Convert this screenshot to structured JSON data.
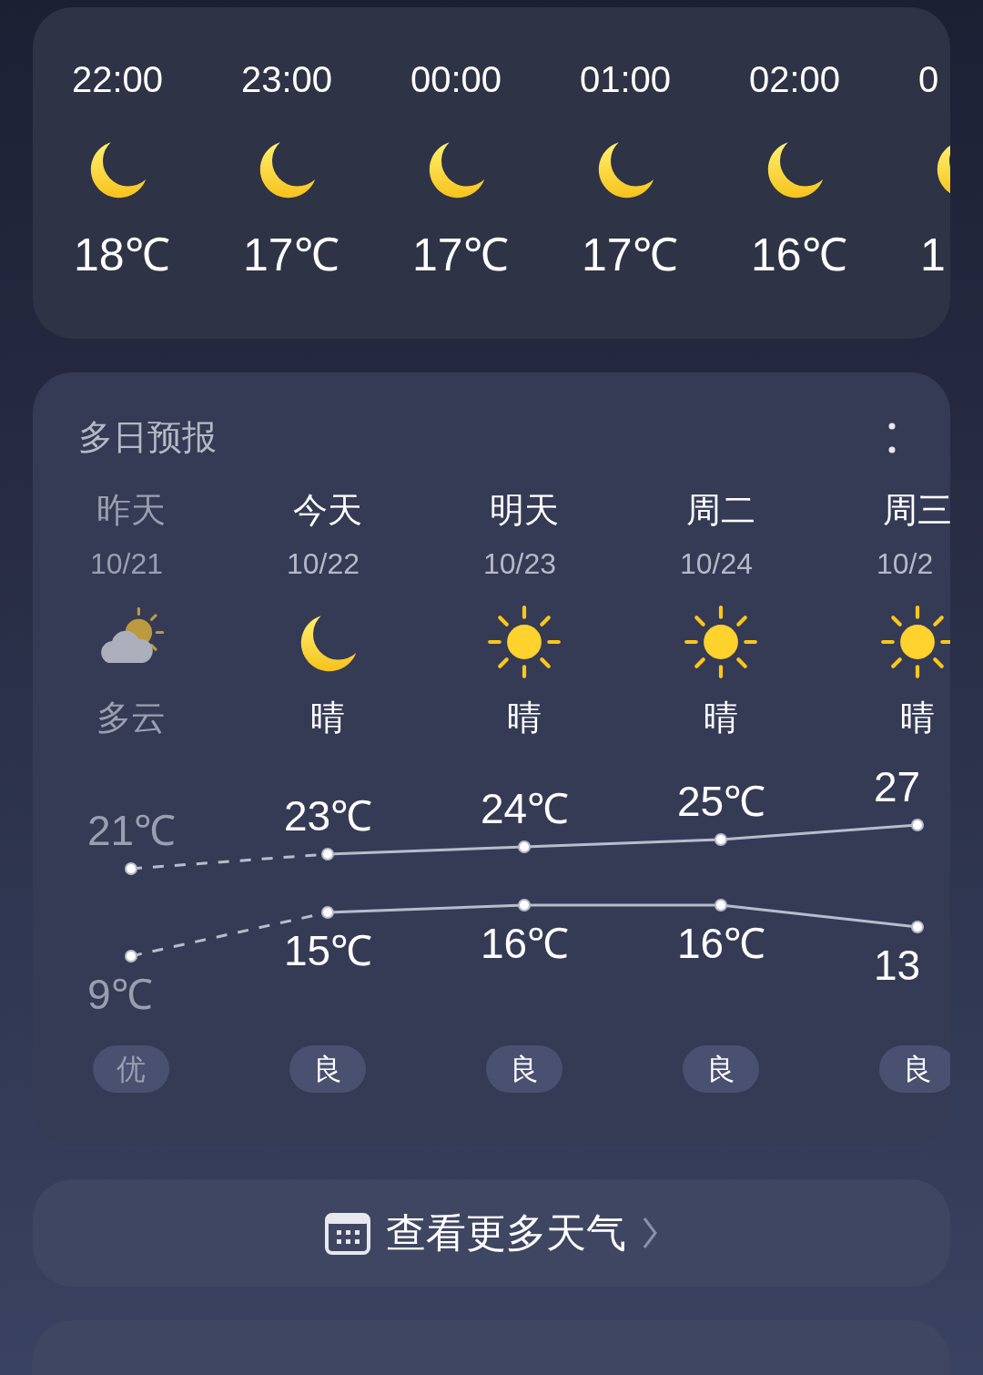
{
  "hourly": [
    {
      "time": "22:00",
      "temp": "18℃",
      "kind": "moon"
    },
    {
      "time": "23:00",
      "temp": "17℃",
      "kind": "moon"
    },
    {
      "time": "00:00",
      "temp": "17℃",
      "kind": "moon"
    },
    {
      "time": "01:00",
      "temp": "17℃",
      "kind": "moon"
    },
    {
      "time": "02:00",
      "temp": "16℃",
      "kind": "moon"
    },
    {
      "time": "0",
      "temp": "1",
      "kind": "moon"
    }
  ],
  "forecast": {
    "title": "多日预报",
    "days": [
      {
        "name": "昨天",
        "date": "10/21",
        "kind": "cloudy",
        "weather": "多云",
        "air": "优",
        "past": true
      },
      {
        "name": "今天",
        "date": "10/22",
        "kind": "moon",
        "weather": "晴",
        "air": "良",
        "past": false
      },
      {
        "name": "明天",
        "date": "10/23",
        "kind": "sun",
        "weather": "晴",
        "air": "良",
        "past": false
      },
      {
        "name": "周二",
        "date": "10/24",
        "kind": "sun",
        "weather": "晴",
        "air": "良",
        "past": false
      },
      {
        "name": "周三",
        "date": "10/2",
        "kind": "sun",
        "weather": "晴",
        "air": "良",
        "past": false
      }
    ],
    "chart_data": {
      "type": "line",
      "series": [
        {
          "color": "#b8bdcc",
          "line_style": "dashed_start",
          "marker": "circle",
          "values": [
            21,
            23,
            24,
            25,
            27
          ],
          "value_labels": [
            "21℃",
            "23℃",
            "24℃",
            "25℃",
            "27"
          ]
        },
        {
          "color": "#b8bdcc",
          "line_style": "dashed_start",
          "marker": "circle",
          "values": [
            9,
            15,
            16,
            16,
            13
          ],
          "value_labels": [
            "9℃",
            "15℃",
            "16℃",
            "16℃",
            "13"
          ]
        }
      ]
    }
  },
  "more_button": {
    "label": "查看更多天气"
  }
}
